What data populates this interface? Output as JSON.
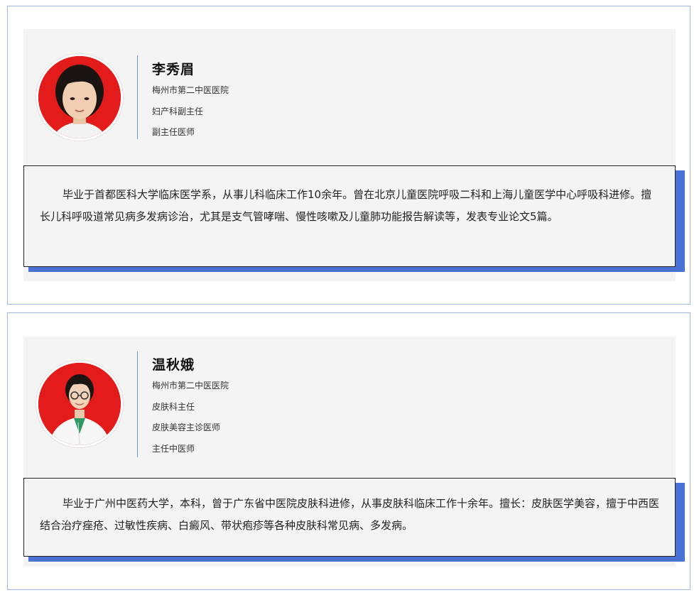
{
  "doctors": [
    {
      "name": "李秀眉",
      "info": [
        "梅州市第二中医医院",
        "妇产科副主任",
        "副主任医师"
      ],
      "bio": "毕业于首都医科大学临床医学系，从事儿科临床工作10余年。曾在北京儿童医院呼吸二科和上海儿童医学中心呼吸科进修。擅长儿科呼吸道常见病多发病诊治，尤其是支气管哮喘、慢性咳嗽及儿童肺功能报告解读等，发表专业论文5篇。"
    },
    {
      "name": "温秋娥",
      "info": [
        "梅州市第二中医医院",
        "皮肤科主任",
        "皮肤美容主诊医师",
        "主任中医师"
      ],
      "bio": "毕业于广州中医药大学，本科，曾于广东省中医院皮肤科进修，从事皮肤科临床工作十余年。擅长：皮肤医学美容，擅于中西医结合治疗痤疮、过敏性疾病、白癜风、带状疱疹等各种皮肤科常见病、多发病。"
    }
  ],
  "colors": {
    "accent": "#4872d4",
    "avatar_bg": "#e31b1b",
    "panel": "#f4f4f4",
    "border": "#9fb7e3"
  }
}
